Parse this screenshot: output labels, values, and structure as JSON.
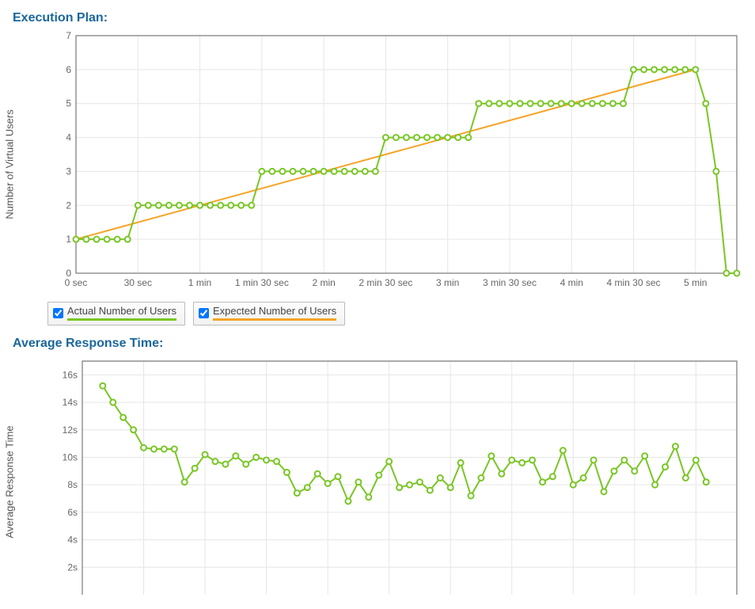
{
  "section1": {
    "title": "Execution Plan:",
    "axis_label": "Number of Virtual Users"
  },
  "section2": {
    "title": "Average Response Time:",
    "axis_label": "Average Response Time"
  },
  "legend": {
    "actual": "Actual Number of Users",
    "expected": "Expected Number of Users"
  },
  "colors": {
    "actual": "#79c625",
    "expected": "#f5a427",
    "grid": "#e6e6e6",
    "border": "#777"
  },
  "chart_data": [
    {
      "type": "line",
      "title": "Execution Plan",
      "ylabel": "Number of Virtual Users",
      "ylim": [
        0,
        7
      ],
      "x_seconds": {
        "min": 0,
        "max": 320
      },
      "x_ticks": [
        {
          "v": 0,
          "l": "0 sec"
        },
        {
          "v": 30,
          "l": "30 sec"
        },
        {
          "v": 60,
          "l": "1 min"
        },
        {
          "v": 90,
          "l": "1 min 30 sec"
        },
        {
          "v": 120,
          "l": "2 min"
        },
        {
          "v": 150,
          "l": "2 min 30 sec"
        },
        {
          "v": 180,
          "l": "3 min"
        },
        {
          "v": 210,
          "l": "3 min 30 sec"
        },
        {
          "v": 240,
          "l": "4 min"
        },
        {
          "v": 270,
          "l": "4 min 30 sec"
        },
        {
          "v": 300,
          "l": "5 min"
        }
      ],
      "y_ticks": [
        0,
        1,
        2,
        3,
        4,
        5,
        6,
        7
      ],
      "series": [
        {
          "name": "Expected Number of Users",
          "color": "#f5a427",
          "markers": false,
          "points": [
            {
              "x": 0,
              "y": 1
            },
            {
              "x": 300,
              "y": 6
            }
          ]
        },
        {
          "name": "Actual Number of Users",
          "color": "#79c625",
          "markers": true,
          "points": [
            {
              "x": 0,
              "y": 1
            },
            {
              "x": 5,
              "y": 1
            },
            {
              "x": 10,
              "y": 1
            },
            {
              "x": 15,
              "y": 1
            },
            {
              "x": 20,
              "y": 1
            },
            {
              "x": 25,
              "y": 1
            },
            {
              "x": 30,
              "y": 2
            },
            {
              "x": 35,
              "y": 2
            },
            {
              "x": 40,
              "y": 2
            },
            {
              "x": 45,
              "y": 2
            },
            {
              "x": 50,
              "y": 2
            },
            {
              "x": 55,
              "y": 2
            },
            {
              "x": 60,
              "y": 2
            },
            {
              "x": 65,
              "y": 2
            },
            {
              "x": 70,
              "y": 2
            },
            {
              "x": 75,
              "y": 2
            },
            {
              "x": 80,
              "y": 2
            },
            {
              "x": 85,
              "y": 2
            },
            {
              "x": 90,
              "y": 3
            },
            {
              "x": 95,
              "y": 3
            },
            {
              "x": 100,
              "y": 3
            },
            {
              "x": 105,
              "y": 3
            },
            {
              "x": 110,
              "y": 3
            },
            {
              "x": 115,
              "y": 3
            },
            {
              "x": 120,
              "y": 3
            },
            {
              "x": 125,
              "y": 3
            },
            {
              "x": 130,
              "y": 3
            },
            {
              "x": 135,
              "y": 3
            },
            {
              "x": 140,
              "y": 3
            },
            {
              "x": 145,
              "y": 3
            },
            {
              "x": 150,
              "y": 4
            },
            {
              "x": 155,
              "y": 4
            },
            {
              "x": 160,
              "y": 4
            },
            {
              "x": 165,
              "y": 4
            },
            {
              "x": 170,
              "y": 4
            },
            {
              "x": 175,
              "y": 4
            },
            {
              "x": 180,
              "y": 4
            },
            {
              "x": 185,
              "y": 4
            },
            {
              "x": 190,
              "y": 4
            },
            {
              "x": 195,
              "y": 5
            },
            {
              "x": 200,
              "y": 5
            },
            {
              "x": 205,
              "y": 5
            },
            {
              "x": 210,
              "y": 5
            },
            {
              "x": 215,
              "y": 5
            },
            {
              "x": 220,
              "y": 5
            },
            {
              "x": 225,
              "y": 5
            },
            {
              "x": 230,
              "y": 5
            },
            {
              "x": 235,
              "y": 5
            },
            {
              "x": 240,
              "y": 5
            },
            {
              "x": 245,
              "y": 5
            },
            {
              "x": 250,
              "y": 5
            },
            {
              "x": 255,
              "y": 5
            },
            {
              "x": 260,
              "y": 5
            },
            {
              "x": 265,
              "y": 5
            },
            {
              "x": 270,
              "y": 6
            },
            {
              "x": 275,
              "y": 6
            },
            {
              "x": 280,
              "y": 6
            },
            {
              "x": 285,
              "y": 6
            },
            {
              "x": 290,
              "y": 6
            },
            {
              "x": 295,
              "y": 6
            },
            {
              "x": 300,
              "y": 6
            },
            {
              "x": 305,
              "y": 5
            },
            {
              "x": 310,
              "y": 3
            },
            {
              "x": 315,
              "y": 0
            },
            {
              "x": 320,
              "y": 0
            }
          ]
        }
      ]
    },
    {
      "type": "line",
      "title": "Average Response Time",
      "ylabel": "Average Response Time",
      "ylim": [
        0,
        17
      ],
      "x_seconds": {
        "min": 0,
        "max": 320
      },
      "y_ticks": [
        {
          "v": 2,
          "l": "2s"
        },
        {
          "v": 4,
          "l": "4s"
        },
        {
          "v": 6,
          "l": "6s"
        },
        {
          "v": 8,
          "l": "8s"
        },
        {
          "v": 10,
          "l": "10s"
        },
        {
          "v": 12,
          "l": "12s"
        },
        {
          "v": 14,
          "l": "14s"
        },
        {
          "v": 16,
          "l": "16s"
        }
      ],
      "series": [
        {
          "name": "Average Response Time",
          "color": "#79c625",
          "markers": true,
          "points": [
            {
              "x": 10,
              "y": 15.2
            },
            {
              "x": 15,
              "y": 14.0
            },
            {
              "x": 20,
              "y": 12.9
            },
            {
              "x": 25,
              "y": 12.0
            },
            {
              "x": 30,
              "y": 10.7
            },
            {
              "x": 35,
              "y": 10.6
            },
            {
              "x": 40,
              "y": 10.6
            },
            {
              "x": 45,
              "y": 10.6
            },
            {
              "x": 50,
              "y": 8.2
            },
            {
              "x": 55,
              "y": 9.2
            },
            {
              "x": 60,
              "y": 10.2
            },
            {
              "x": 65,
              "y": 9.7
            },
            {
              "x": 70,
              "y": 9.5
            },
            {
              "x": 75,
              "y": 10.1
            },
            {
              "x": 80,
              "y": 9.5
            },
            {
              "x": 85,
              "y": 10.0
            },
            {
              "x": 90,
              "y": 9.8
            },
            {
              "x": 95,
              "y": 9.7
            },
            {
              "x": 100,
              "y": 8.9
            },
            {
              "x": 105,
              "y": 7.4
            },
            {
              "x": 110,
              "y": 7.8
            },
            {
              "x": 115,
              "y": 8.8
            },
            {
              "x": 120,
              "y": 8.1
            },
            {
              "x": 125,
              "y": 8.6
            },
            {
              "x": 130,
              "y": 6.8
            },
            {
              "x": 135,
              "y": 8.2
            },
            {
              "x": 140,
              "y": 7.1
            },
            {
              "x": 145,
              "y": 8.7
            },
            {
              "x": 150,
              "y": 9.7
            },
            {
              "x": 155,
              "y": 7.8
            },
            {
              "x": 160,
              "y": 8.0
            },
            {
              "x": 165,
              "y": 8.2
            },
            {
              "x": 170,
              "y": 7.6
            },
            {
              "x": 175,
              "y": 8.5
            },
            {
              "x": 180,
              "y": 7.8
            },
            {
              "x": 185,
              "y": 9.6
            },
            {
              "x": 190,
              "y": 7.2
            },
            {
              "x": 195,
              "y": 8.5
            },
            {
              "x": 200,
              "y": 10.1
            },
            {
              "x": 205,
              "y": 8.8
            },
            {
              "x": 210,
              "y": 9.8
            },
            {
              "x": 215,
              "y": 9.6
            },
            {
              "x": 220,
              "y": 9.8
            },
            {
              "x": 225,
              "y": 8.2
            },
            {
              "x": 230,
              "y": 8.6
            },
            {
              "x": 235,
              "y": 10.5
            },
            {
              "x": 240,
              "y": 8.0
            },
            {
              "x": 245,
              "y": 8.5
            },
            {
              "x": 250,
              "y": 9.8
            },
            {
              "x": 255,
              "y": 7.5
            },
            {
              "x": 260,
              "y": 9.0
            },
            {
              "x": 265,
              "y": 9.8
            },
            {
              "x": 270,
              "y": 9.0
            },
            {
              "x": 275,
              "y": 10.1
            },
            {
              "x": 280,
              "y": 8.0
            },
            {
              "x": 285,
              "y": 9.3
            },
            {
              "x": 290,
              "y": 10.8
            },
            {
              "x": 295,
              "y": 8.5
            },
            {
              "x": 300,
              "y": 9.8
            },
            {
              "x": 305,
              "y": 8.2
            }
          ]
        }
      ]
    }
  ]
}
